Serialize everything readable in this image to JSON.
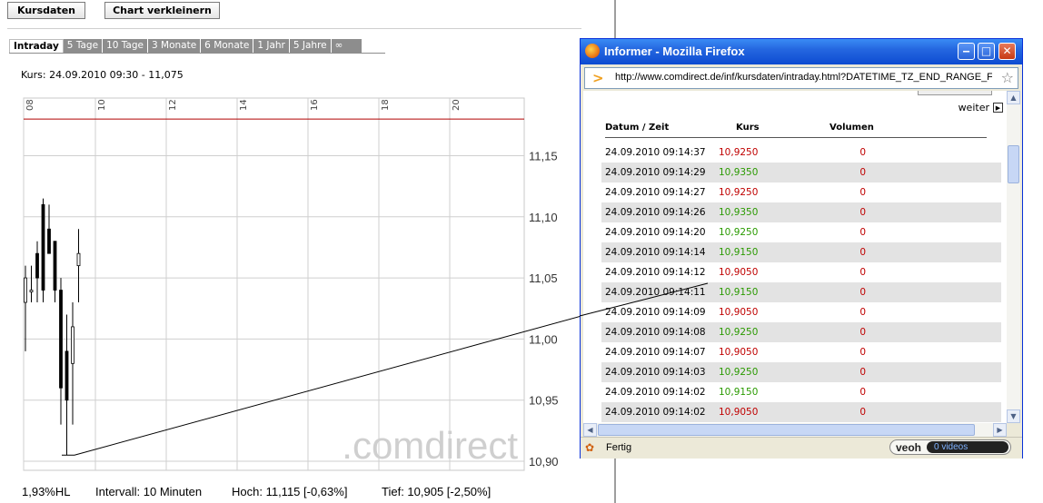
{
  "toolbar": {
    "kursdaten_label": "Kursdaten",
    "chart_label": "Chart verkleinern"
  },
  "tabs": [
    "Intraday",
    "5 Tage",
    "10 Tage",
    "3 Monate",
    "6 Monate",
    "1 Jahr",
    "5 Jahre",
    "∞"
  ],
  "kurs_label": "Kurs: 24.09.2010 09:30 - 11,075",
  "chart_data": {
    "type": "candlestick",
    "x_ticks": [
      "08",
      "10",
      "12",
      "14",
      "16",
      "18",
      "20"
    ],
    "y_ticks": [
      "11,15",
      "11,10",
      "11,05",
      "11,00",
      "10,95",
      "10,90"
    ],
    "ylim": [
      10.9,
      11.15
    ],
    "reference_line": 11.18,
    "reference_color": "#b00000",
    "candles": [
      {
        "open": 11.03,
        "high": 11.06,
        "low": 10.99,
        "close": 11.05
      },
      {
        "open": 11.04,
        "high": 11.06,
        "low": 11.03,
        "close": 11.04
      },
      {
        "open": 11.07,
        "high": 11.08,
        "low": 11.03,
        "close": 11.05
      },
      {
        "open": 11.11,
        "high": 11.115,
        "low": 11.03,
        "close": 11.04
      },
      {
        "open": 11.09,
        "high": 11.11,
        "low": 11.07,
        "close": 11.07
      },
      {
        "open": 11.08,
        "high": 11.08,
        "low": 11.03,
        "close": 11.04
      },
      {
        "open": 11.04,
        "high": 11.05,
        "low": 10.93,
        "close": 10.96
      },
      {
        "open": 10.99,
        "high": 11.02,
        "low": 10.905,
        "close": 10.95
      },
      {
        "open": 10.98,
        "high": 11.03,
        "low": 10.93,
        "close": 11.01
      },
      {
        "open": 11.06,
        "high": 11.09,
        "low": 11.03,
        "close": 11.07
      }
    ],
    "watermark": ".comdirect"
  },
  "bottom": {
    "hl": "1,93%HL",
    "intervall": "Intervall: 10 Minuten",
    "hoch": "Hoch:  11,115 [-0,63%]",
    "tief": "Tief:  10,905 [-2,50%]"
  },
  "firefox": {
    "title": "Informer - Mozilla Firefox",
    "url": "http://www.comdirect.de/inf/kursdaten/intraday.html?DATETIME_TZ_END_RANGE_FC",
    "weiter": "weiter",
    "status": "Fertig",
    "veoh": "veoh",
    "videos": "0  videos"
  },
  "table": {
    "headers": [
      "Datum / Zeit",
      "Kurs",
      "Volumen"
    ],
    "rows": [
      {
        "time": "24.09.2010  09:14:37",
        "kurs": "10,9250",
        "color": "red",
        "vol": "0"
      },
      {
        "time": "24.09.2010  09:14:29",
        "kurs": "10,9350",
        "color": "green",
        "vol": "0"
      },
      {
        "time": "24.09.2010  09:14:27",
        "kurs": "10,9250",
        "color": "red",
        "vol": "0"
      },
      {
        "time": "24.09.2010  09:14:26",
        "kurs": "10,9350",
        "color": "green",
        "vol": "0"
      },
      {
        "time": "24.09.2010  09:14:20",
        "kurs": "10,9250",
        "color": "green",
        "vol": "0"
      },
      {
        "time": "24.09.2010  09:14:14",
        "kurs": "10,9150",
        "color": "green",
        "vol": "0"
      },
      {
        "time": "24.09.2010  09:14:12",
        "kurs": "10,9050",
        "color": "red",
        "vol": "0"
      },
      {
        "time": "24.09.2010  09:14:11",
        "kurs": "10,9150",
        "color": "green",
        "vol": "0"
      },
      {
        "time": "24.09.2010  09:14:09",
        "kurs": "10,9050",
        "color": "red",
        "vol": "0"
      },
      {
        "time": "24.09.2010  09:14:08",
        "kurs": "10,9250",
        "color": "green",
        "vol": "0"
      },
      {
        "time": "24.09.2010  09:14:07",
        "kurs": "10,9050",
        "color": "red",
        "vol": "0"
      },
      {
        "time": "24.09.2010  09:14:03",
        "kurs": "10,9250",
        "color": "green",
        "vol": "0"
      },
      {
        "time": "24.09.2010  09:14:02",
        "kurs": "10,9150",
        "color": "green",
        "vol": "0"
      },
      {
        "time": "24.09.2010  09:14:02",
        "kurs": "10,9050",
        "color": "red",
        "vol": "0"
      }
    ]
  }
}
